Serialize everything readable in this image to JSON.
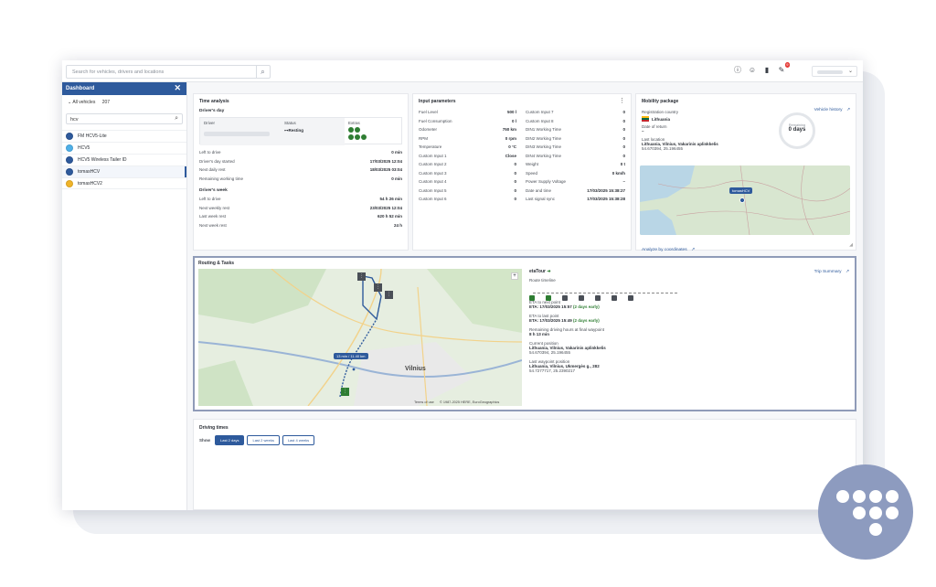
{
  "topbar": {
    "search_placeholder": "Search for vehicles, drivers and locations",
    "notification_count": "9"
  },
  "sidebar": {
    "title": "Dashboard",
    "all_vehicles_label": "All vehicles",
    "all_vehicles_count": "207",
    "search_value": "hcv",
    "vehicles": [
      {
        "name": "FM HCV5-Lite",
        "color": "#2e5a9c"
      },
      {
        "name": "HCV5",
        "color": "#4fb0e8"
      },
      {
        "name": "HCV5 Wireless Tailer ID",
        "color": "#2e5a9c"
      },
      {
        "name": "tomasHCV",
        "color": "#2e5a9c"
      },
      {
        "name": "tomasHCV2",
        "color": "#f0b429"
      }
    ]
  },
  "time_analysis": {
    "title": "Time analysis",
    "drivers_day": "Driver's day",
    "col_driver": "Driver",
    "col_status": "Status",
    "col_extras": "Extras",
    "status_value": "Resting",
    "day_rows": [
      {
        "label": "Left to drive",
        "value": "0 min"
      },
      {
        "label": "Driver's day started",
        "value": "17/03/2025 12:04"
      },
      {
        "label": "Next daily rest",
        "value": "18/03/2025 03:04"
      },
      {
        "label": "Remaining working time",
        "value": "0 min"
      }
    ],
    "drivers_week": "Driver's week",
    "week_rows": [
      {
        "label": "Left to drive",
        "value": "54 h 26 min"
      },
      {
        "label": "Next weekly rest",
        "value": "23/03/2025 12:04"
      },
      {
        "label": "Last week rest",
        "value": "620 h 52 min"
      },
      {
        "label": "Next week rest",
        "value": "24 h"
      }
    ]
  },
  "input_parameters": {
    "title": "Input parameters",
    "left": [
      {
        "label": "Fuel Level",
        "value": "500 l"
      },
      {
        "label": "Fuel Consumption",
        "value": "0 l"
      },
      {
        "label": "Odometer",
        "value": "750 km"
      },
      {
        "label": "RPM",
        "value": "0 rpm"
      },
      {
        "label": "Temperature",
        "value": "0 °C"
      },
      {
        "label": "Custom Input 1",
        "value": "Close"
      },
      {
        "label": "Custom Input 2",
        "value": "0"
      },
      {
        "label": "Custom Input 3",
        "value": "0"
      },
      {
        "label": "Custom Input 4",
        "value": "0"
      },
      {
        "label": "Custom Input 5",
        "value": "0"
      },
      {
        "label": "Custom Input 6",
        "value": "0"
      }
    ],
    "right": [
      {
        "label": "Custom Input 7",
        "value": "0"
      },
      {
        "label": "Custom Input 8",
        "value": "0"
      },
      {
        "label": "DIN1 Working Time",
        "value": "0"
      },
      {
        "label": "DIN2 Working Time",
        "value": "0"
      },
      {
        "label": "DIN3 Working Time",
        "value": "0"
      },
      {
        "label": "DIN4 Working Time",
        "value": "0"
      },
      {
        "label": "Weight",
        "value": "0 t"
      },
      {
        "label": "Speed",
        "value": "0 km/h"
      },
      {
        "label": "Power Supply Voltage",
        "value": "–"
      },
      {
        "label": "Date and time",
        "value": "17/03/2025 15:38:27"
      },
      {
        "label": "Last signal sync",
        "value": "17/03/2025 15:38:28"
      }
    ]
  },
  "mobility": {
    "title": "Mobility package",
    "vehicle_history": "Vehicle history",
    "registration_country_label": "Registration country",
    "registration_country": "Lithuania",
    "date_of_return_label": "Date of return",
    "date_of_return": "–",
    "remaining_label": "Remaining",
    "remaining_value": "0 days",
    "last_location_label": "Last location",
    "last_location": "Lithuania, Vilnius, Vakarinis aplinkkelis",
    "last_coords": "54.670394, 25.196455",
    "map_badge": "tomasHCV",
    "analyze_link": "Analyze by coordinates"
  },
  "routing": {
    "title": "Routing & Tasks",
    "trip_summary": "Trip Summary",
    "map_badge": "13 min / 11.40 km",
    "map_label_city": "Vilnius",
    "map_terms": "Terms of use",
    "map_copyright": "© 1987-2025 HERE, EuroGeographics",
    "tour_name": "etaTour",
    "route_timeline_label": "Route timeline",
    "eta_next_label": "ETA to next point",
    "eta_next_value": "ETA: 17/03/2025 15:57",
    "eta_next_early": "(2 days early)",
    "eta_last_label": "ETA to last point",
    "eta_last_value": "ETA: 17/03/2025 15:49",
    "eta_last_early": "(2 days early)",
    "remaining_hours_label": "Remaining driving hours at final waypoint",
    "remaining_hours_value": "8 h 13 min",
    "current_position_label": "Current position",
    "current_position": "Lithuania, Vilnius, Vakarinis aplinkkelis",
    "current_coords": "54.670394, 25.196455",
    "last_waypoint_label": "Last waypoint position",
    "last_waypoint": "Lithuania, Vilnius, Ukmergės g., 282",
    "last_waypoint_coords": "54.7277717, 25.2390217"
  },
  "driving_times": {
    "title": "Driving times",
    "show_label": "Show",
    "tabs": [
      "Last 2 days",
      "Last 2 weeks",
      "Last 4 weeks"
    ]
  }
}
